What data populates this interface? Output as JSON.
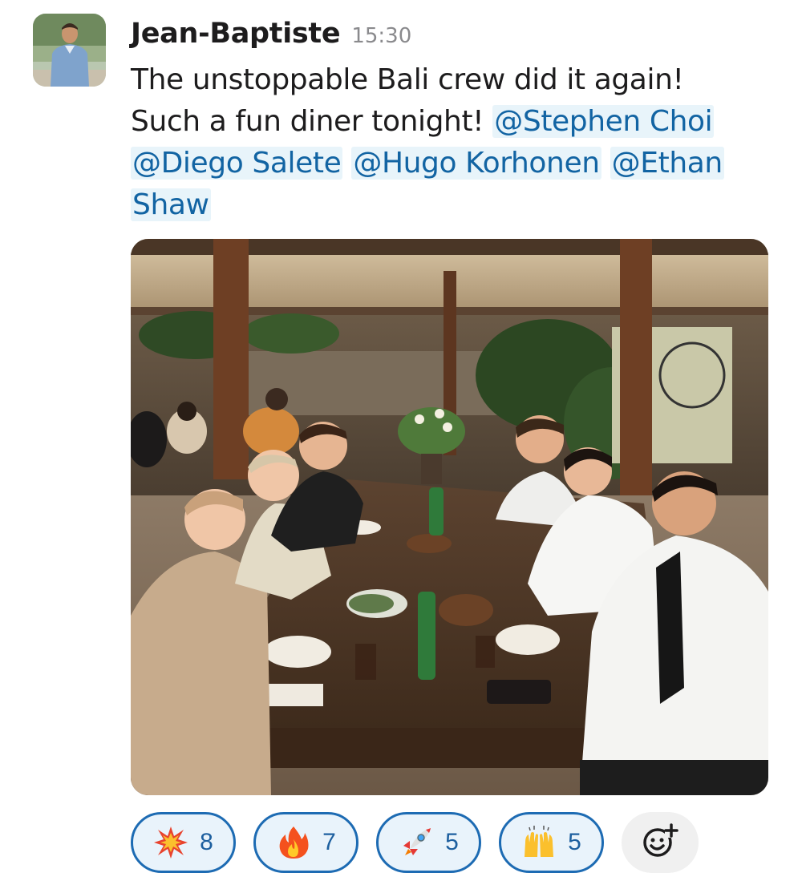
{
  "message": {
    "author": "Jean-Baptiste",
    "timestamp": "15:30",
    "text": {
      "line1": "The unstoppable Bali crew did it again!",
      "line2_prefix": "Such a fun diner tonight!",
      "mentions": {
        "stephen": "@Stephen Choi",
        "diego": "@Diego Salete",
        "hugo": "@Hugo Korhonen",
        "ethan_part1": "@Ethan",
        "ethan_part2": "Shaw"
      }
    },
    "image": {
      "alt": "Group photo at restaurant table"
    }
  },
  "reactions": [
    {
      "emoji": "collision-icon",
      "count": "8"
    },
    {
      "emoji": "fire-icon",
      "count": "7"
    },
    {
      "emoji": "rocket-icon",
      "count": "5"
    },
    {
      "emoji": "raising-hands-icon",
      "count": "5"
    }
  ],
  "colors": {
    "mention_text": "#1264a3",
    "mention_bg": "#e8f4fa",
    "reaction_border": "#1d6bb3",
    "reaction_bg": "#e9f3fb"
  }
}
